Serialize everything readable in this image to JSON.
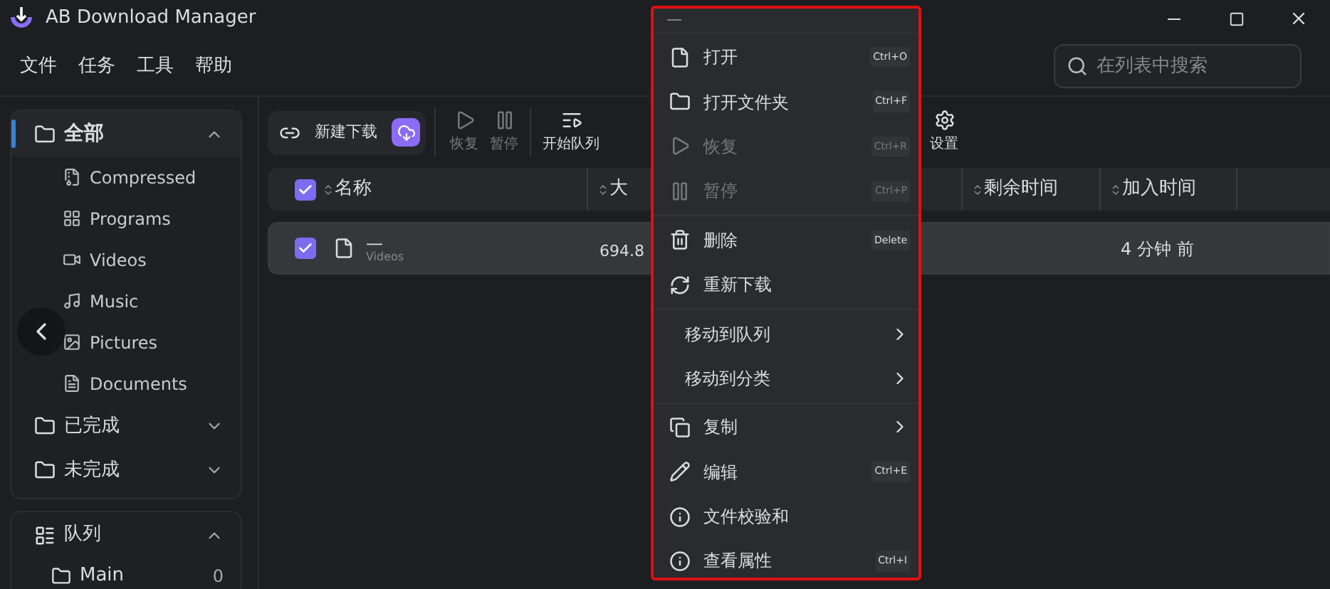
{
  "window": {
    "title": "AB Download Manager"
  },
  "menu_bar": [
    "文件",
    "任务",
    "工具",
    "帮助"
  ],
  "search": {
    "placeholder": "在列表中搜索"
  },
  "sidebar": {
    "categories": {
      "label": "全部",
      "selected": true,
      "expanded": true,
      "children": [
        {
          "label": "Compressed"
        },
        {
          "label": "Programs"
        },
        {
          "label": "Videos"
        },
        {
          "label": "Music"
        },
        {
          "label": "Pictures"
        },
        {
          "label": "Documents"
        }
      ]
    },
    "statuses": [
      {
        "label": "已完成",
        "expanded": false
      },
      {
        "label": "未完成",
        "expanded": false
      }
    ],
    "queues": {
      "label": "队列",
      "expanded": true,
      "children": [
        {
          "label": "Main",
          "count": "0"
        }
      ]
    }
  },
  "toolbar": {
    "new_download": "新建下载",
    "buttons": [
      {
        "label": "恢复",
        "disabled": true
      },
      {
        "label": "暂停",
        "disabled": true
      },
      {
        "label": "开始队列",
        "disabled": false
      }
    ],
    "settings": "设置"
  },
  "table": {
    "columns": [
      "名称",
      "大",
      "剩余时间",
      "加入时间"
    ],
    "all_checked": true,
    "rows": [
      {
        "checked": true,
        "name": "—",
        "category": "Videos",
        "size": "694.8",
        "added": "4 分钟 前"
      }
    ]
  },
  "context_menu": {
    "header": "—",
    "groups": [
      [
        {
          "label": "打开",
          "shortcut": "Ctrl+O",
          "disabled": false
        },
        {
          "label": "打开文件夹",
          "shortcut": "Ctrl+F",
          "disabled": false
        },
        {
          "label": "恢复",
          "shortcut": "Ctrl+R",
          "disabled": true
        },
        {
          "label": "暂停",
          "shortcut": "Ctrl+P",
          "disabled": true
        }
      ],
      [
        {
          "label": "删除",
          "shortcut": "Delete",
          "disabled": false
        },
        {
          "label": "重新下载",
          "disabled": false
        }
      ],
      [
        {
          "label": "移动到队列",
          "submenu": true,
          "disabled": false
        },
        {
          "label": "移动到分类",
          "submenu": true,
          "disabled": false
        }
      ],
      [
        {
          "label": "复制",
          "submenu": true,
          "disabled": false
        },
        {
          "label": "编辑",
          "shortcut": "Ctrl+E",
          "disabled": false
        },
        {
          "label": "文件校验和",
          "disabled": false
        },
        {
          "label": "查看属性",
          "shortcut": "Ctrl+I",
          "disabled": false
        }
      ]
    ]
  }
}
